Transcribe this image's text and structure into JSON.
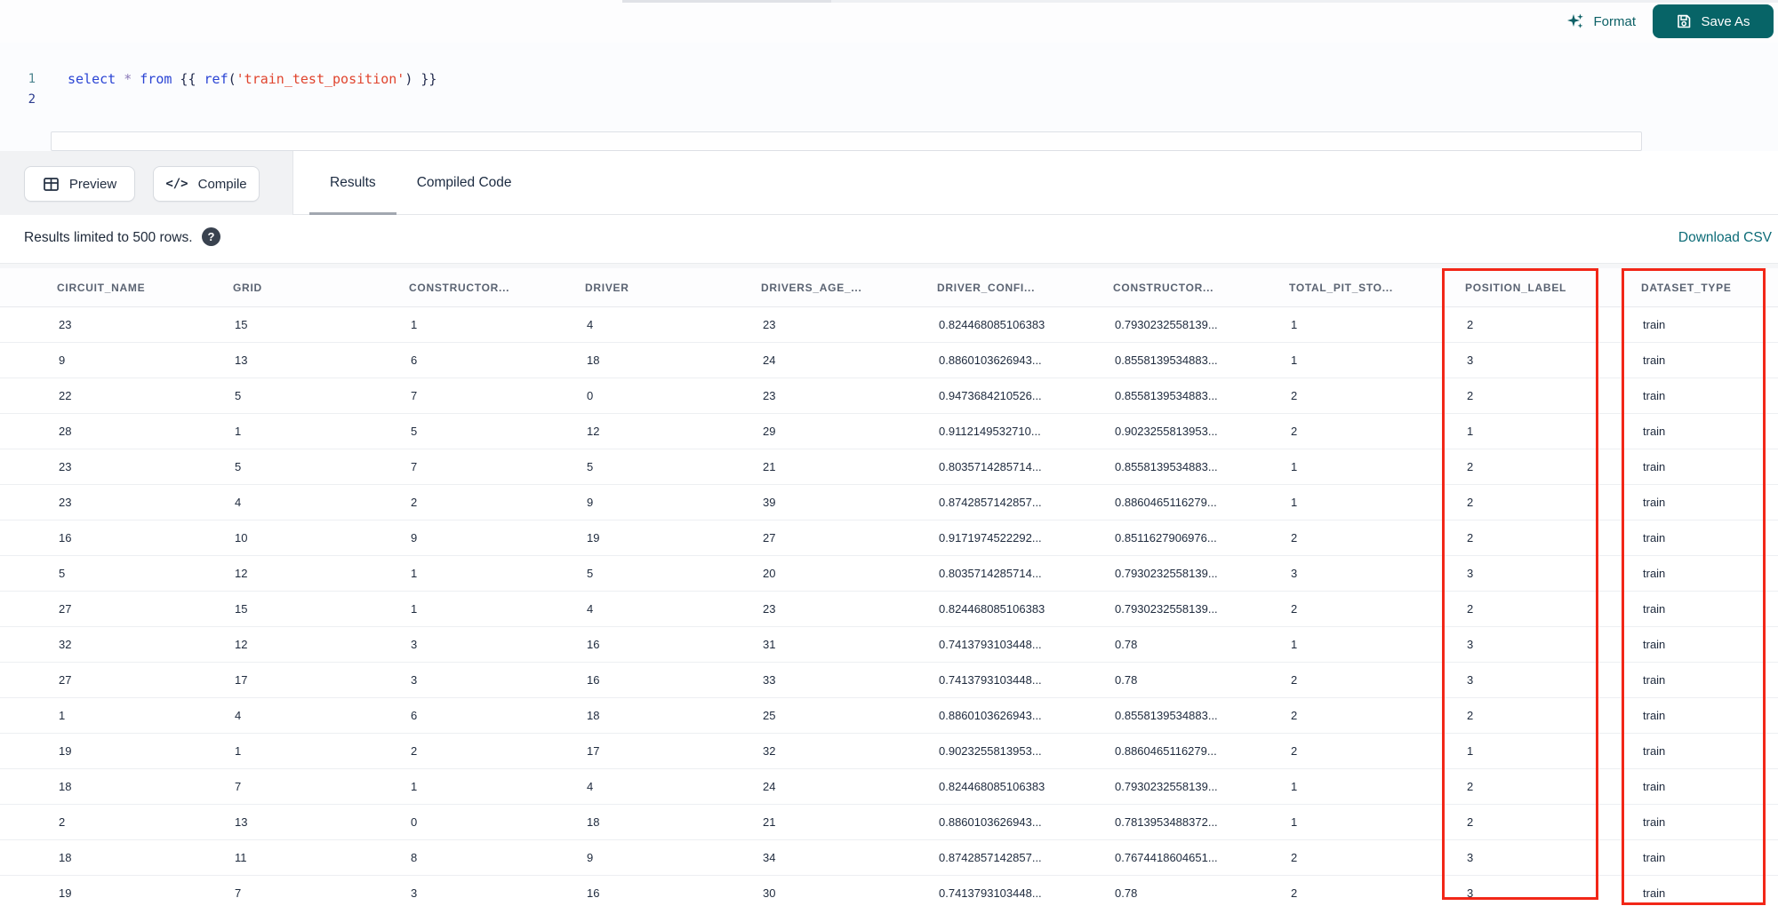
{
  "colors": {
    "accent_teal": "#076467",
    "link_teal": "#0c6b77",
    "annotation_red": "#f22718"
  },
  "topbar": {
    "format_label": "Format",
    "save_as_label": "Save As"
  },
  "editor": {
    "lines": [
      {
        "number": "1",
        "tokens": [
          {
            "type": "keyword",
            "text": "select"
          },
          {
            "type": "operator",
            "text": " * "
          },
          {
            "type": "keyword",
            "text": "from"
          },
          {
            "type": "jinja",
            "text": " {{ "
          },
          {
            "type": "keyword",
            "text": "ref"
          },
          {
            "type": "jinja",
            "text": "("
          },
          {
            "type": "string",
            "text": "'train_test_position'"
          },
          {
            "type": "jinja",
            "text": ") }}"
          }
        ]
      },
      {
        "number": "2",
        "tokens": []
      }
    ]
  },
  "toolbar": {
    "preview_label": "Preview",
    "compile_label": "Compile",
    "tabs": [
      {
        "label": "Results",
        "active": true
      },
      {
        "label": "Compiled Code",
        "active": false
      }
    ]
  },
  "results_bar": {
    "info": "Results limited to 500 rows.",
    "help_glyph": "?",
    "download_label": "Download CSV"
  },
  "table": {
    "columns": [
      "CIRCUIT_NAME",
      "GRID",
      "CONSTRUCTOR...",
      "DRIVER",
      "DRIVERS_AGE_...",
      "DRIVER_CONFI...",
      "CONSTRUCTOR...",
      "TOTAL_PIT_STO...",
      "POSITION_LABEL",
      "DATASET_TYPE"
    ],
    "highlighted_columns": [
      "POSITION_LABEL",
      "DATASET_TYPE"
    ],
    "rows": [
      [
        "23",
        "15",
        "1",
        "4",
        "23",
        "0.824468085106383",
        "0.7930232558139...",
        "1",
        "2",
        "train"
      ],
      [
        "9",
        "13",
        "6",
        "18",
        "24",
        "0.8860103626943...",
        "0.8558139534883...",
        "1",
        "3",
        "train"
      ],
      [
        "22",
        "5",
        "7",
        "0",
        "23",
        "0.9473684210526...",
        "0.8558139534883...",
        "2",
        "2",
        "train"
      ],
      [
        "28",
        "1",
        "5",
        "12",
        "29",
        "0.9112149532710...",
        "0.9023255813953...",
        "2",
        "1",
        "train"
      ],
      [
        "23",
        "5",
        "7",
        "5",
        "21",
        "0.8035714285714...",
        "0.8558139534883...",
        "1",
        "2",
        "train"
      ],
      [
        "23",
        "4",
        "2",
        "9",
        "39",
        "0.8742857142857...",
        "0.8860465116279...",
        "1",
        "2",
        "train"
      ],
      [
        "16",
        "10",
        "9",
        "19",
        "27",
        "0.9171974522292...",
        "0.8511627906976...",
        "2",
        "2",
        "train"
      ],
      [
        "5",
        "12",
        "1",
        "5",
        "20",
        "0.8035714285714...",
        "0.7930232558139...",
        "3",
        "3",
        "train"
      ],
      [
        "27",
        "15",
        "1",
        "4",
        "23",
        "0.824468085106383",
        "0.7930232558139...",
        "2",
        "2",
        "train"
      ],
      [
        "32",
        "12",
        "3",
        "16",
        "31",
        "0.7413793103448...",
        "0.78",
        "1",
        "3",
        "train"
      ],
      [
        "27",
        "17",
        "3",
        "16",
        "33",
        "0.7413793103448...",
        "0.78",
        "2",
        "3",
        "train"
      ],
      [
        "1",
        "4",
        "6",
        "18",
        "25",
        "0.8860103626943...",
        "0.8558139534883...",
        "2",
        "2",
        "train"
      ],
      [
        "19",
        "1",
        "2",
        "17",
        "32",
        "0.9023255813953...",
        "0.8860465116279...",
        "2",
        "1",
        "train"
      ],
      [
        "18",
        "7",
        "1",
        "4",
        "24",
        "0.824468085106383",
        "0.7930232558139...",
        "1",
        "2",
        "train"
      ],
      [
        "2",
        "13",
        "0",
        "18",
        "21",
        "0.8860103626943...",
        "0.7813953488372...",
        "1",
        "2",
        "train"
      ],
      [
        "18",
        "11",
        "8",
        "9",
        "34",
        "0.8742857142857...",
        "0.7674418604651...",
        "2",
        "3",
        "train"
      ],
      [
        "19",
        "7",
        "3",
        "16",
        "30",
        "0.7413793103448...",
        "0.78",
        "2",
        "3",
        "train"
      ]
    ]
  }
}
